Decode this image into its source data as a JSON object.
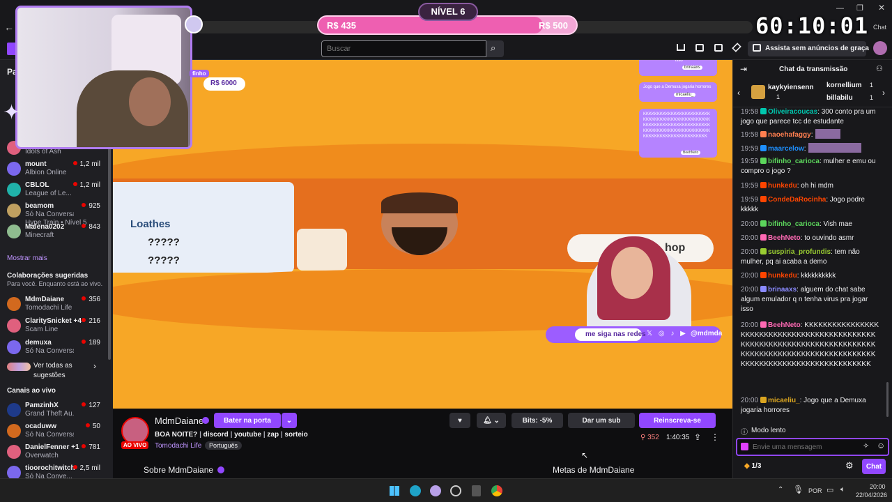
{
  "overlay": {
    "level": "NÍVEL 6",
    "goal_current": "R$ 435",
    "goal_target": "R$ 500",
    "timer": "60:10:01",
    "cam_goal": "R$ 6000",
    "cam_goal_label": "finho"
  },
  "browser": {
    "chat_label": "Chat",
    "back_icon": "back-arrow-icon"
  },
  "topnav": {
    "search_placeholder": "Buscar",
    "adfree_label": "Assista sem anúncios de graça"
  },
  "sidebar": {
    "header": "Pa",
    "followed": [
      {
        "name": "",
        "game": "Idols of Ash",
        "viewers": ""
      },
      {
        "name": "mount",
        "game": "Albion Online",
        "viewers": "1,2 mil"
      },
      {
        "name": "CBLOL",
        "game": "League of Le...",
        "viewers": "1,2 mil"
      },
      {
        "name": "beamom",
        "game": "Só Na Conversa",
        "viewers": "925",
        "extra": "Hype Train • Nível 5"
      },
      {
        "name": "Malena0202",
        "game": "Minecraft",
        "viewers": "843"
      }
    ],
    "show_more": "Mostrar mais",
    "collab_title": "Colaborações sugeridas",
    "collab_sub": "Para você. Enquanto está ao vivo.",
    "collab": [
      {
        "name": "MdmDaiane",
        "game": "Tomodachi Life",
        "viewers": "356"
      },
      {
        "name": "ClaritySnicket +4",
        "game": "Scam Line",
        "viewers": "216"
      },
      {
        "name": "demuxa",
        "game": "Só Na Conversa",
        "viewers": "189"
      }
    ],
    "see_all": "Ver todas as sugestões",
    "live_title": "Canais ao vivo",
    "live": [
      {
        "name": "PamzinhX",
        "game": "Grand Theft Au...",
        "viewers": "127"
      },
      {
        "name": "ocaduww",
        "game": "Só Na Conversa",
        "viewers": "50"
      },
      {
        "name": "DanielFenner +1",
        "game": "Overwatch",
        "viewers": "781"
      },
      {
        "name": "tioorochitwitch",
        "game": "Só Na Conve...",
        "viewers": "2,5 mil"
      }
    ]
  },
  "video": {
    "loathes": "Loathes",
    "q1": "?????",
    "q2": "?????",
    "shop": "hop",
    "follow_text": "me siga nas redes",
    "handle": "@mdmda",
    "popup1": "isso",
    "popup1_user": "brinaaxs",
    "popup2": "Jogo que a Demuxa jogaria horrores",
    "popup2_user": "micaeliu_",
    "popup3": "KKKKKKKKKKKKKKKKKKKKKKKKKKKKKKKKKKKKKKKKKKKKKKKKKKKKKKKKKKKKKKKKKKKKKKKKKKKKKKKKKKKKKKKKKKKKKKKKKKKKKKKKKKKKKKKKKKKKKKK",
    "popup3_user": "BeehNeto"
  },
  "info": {
    "channel": "MdmDaiane",
    "knock": "Bater na porta",
    "title": "BOA NOITE?",
    "tags_links": [
      "discord",
      "youtube",
      "zap",
      "sorteio"
    ],
    "live_badge": "AO VIVO",
    "category": "Tomodachi Life",
    "lang_tag": "Português",
    "bits": "Bits: -5%",
    "sub": "Dar um sub",
    "resub": "Reinscreva-se",
    "viewers": "352",
    "uptime": "1:40:35",
    "about": "Sobre MdmDaiane",
    "goals": "Metas de MdmDaiane"
  },
  "chat": {
    "title": "Chat da transmissão",
    "top_gifter": "kaykyiensenn",
    "top_gifter_count": "1",
    "gifter2": "kornellium",
    "gifter2_count": "1",
    "gifter3": "billabilu",
    "gifter3_count": "1",
    "messages": [
      {
        "time": "19:58",
        "user": "Oliveiracoucas",
        "color": "#00c8af",
        "text": ": 300 conto pra um jogo que parece tcc de estudante"
      },
      {
        "time": "19:58",
        "user": "naoehafaggy",
        "color": "#ff7f50",
        "text": ":"
      },
      {
        "time": "19:59",
        "user": "maarcelow",
        "color": "#1e90ff",
        "text": ":"
      },
      {
        "time": "19:59",
        "user": "bifinho_carioca",
        "color": "#5cd65c",
        "text": ": mulher e emu ou compro o jogo ?"
      },
      {
        "time": "19:59",
        "user": "hunkedu",
        "color": "#ff4500",
        "text": ": oh hi mdm"
      },
      {
        "time": "19:59",
        "user": "CondeDaRocinha",
        "color": "#ff4500",
        "text": ": Jogo podre kkkkk"
      },
      {
        "time": "20:00",
        "user": "bifinho_carioca",
        "color": "#5cd65c",
        "text": ": Vish mae"
      },
      {
        "time": "20:00",
        "user": "BeehNeto",
        "color": "#ff69b4",
        "text": ": to ouvindo asmr"
      },
      {
        "time": "20:00",
        "user": "suspiria_profundis",
        "color": "#9acd32",
        "text": ": tem não mulher, pq ai acaba a demo"
      },
      {
        "time": "20:00",
        "user": "hunkedu",
        "color": "#ff4500",
        "text": ": kkkkkkkkkk"
      },
      {
        "time": "20:00",
        "user": "brinaaxs",
        "color": "#8a8aff",
        "text": ": alguem do chat sabe algum emulador q n tenha virus pra jogar isso"
      },
      {
        "time": "20:00",
        "user": "BeehNeto",
        "color": "#ff69b4",
        "text": ": KKKKKKKKKKKKKKKKKKKKKKKKKKKKKKKKKKKKKKKKKKKKKKKKKKKKKKKKKKKKKKKKKKKKKKKKKKKKKKKKKKKKKKKKKKKKKKKKKKKKKKKKKKKKKKKKKKKKKKKKKKKKKKKKKKK"
      },
      {
        "time": "20:00",
        "user": "micaeliu_",
        "color": "#daa520",
        "text": ": Jogo que a Demuxa jogaria horrores"
      }
    ],
    "slow_mode": "Modo lento",
    "input_placeholder": "Envie uma mensagem",
    "points": "1/3",
    "send": "Chat"
  },
  "taskbar": {
    "lang": "POR",
    "time": "20:00",
    "date": "22/04/2026"
  }
}
